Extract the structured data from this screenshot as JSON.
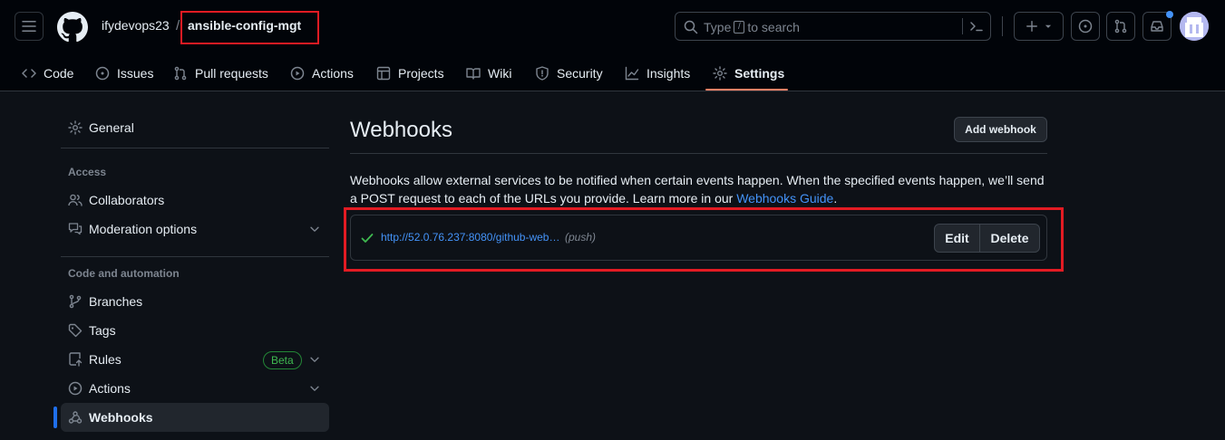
{
  "header": {
    "owner": "ifydevops23",
    "separator": "/",
    "repo": "ansible-config-mgt",
    "search": {
      "prefix": "Type",
      "key": "/",
      "suffix": "to search"
    },
    "icons": [
      "menu-icon",
      "github-logo-icon",
      "search-icon",
      "command-palette-icon",
      "plus-icon",
      "chevron-down-icon",
      "issues-icon",
      "pull-request-icon",
      "inbox-icon",
      "avatar"
    ]
  },
  "tabs": [
    {
      "label": "Code",
      "icon": "code-icon"
    },
    {
      "label": "Issues",
      "icon": "issue-opened-icon"
    },
    {
      "label": "Pull requests",
      "icon": "git-pull-request-icon"
    },
    {
      "label": "Actions",
      "icon": "play-icon"
    },
    {
      "label": "Projects",
      "icon": "table-icon"
    },
    {
      "label": "Wiki",
      "icon": "book-icon"
    },
    {
      "label": "Security",
      "icon": "shield-icon"
    },
    {
      "label": "Insights",
      "icon": "graph-icon"
    },
    {
      "label": "Settings",
      "icon": "gear-icon",
      "active": true
    }
  ],
  "sidebar": {
    "general": "General",
    "access_heading": "Access",
    "collaborators": "Collaborators",
    "moderation": "Moderation options",
    "code_heading": "Code and automation",
    "branches": "Branches",
    "tags": "Tags",
    "rules": "Rules",
    "rules_badge": "Beta",
    "actions": "Actions",
    "webhooks": "Webhooks"
  },
  "main": {
    "title": "Webhooks",
    "add_button": "Add webhook",
    "description_line1": "Webhooks allow external services to be notified when certain events happen. When the specified events happen, we’ll send",
    "description_line2_pre": "a POST request to each of the URLs you provide. Learn more in our ",
    "description_link": "Webhooks Guide",
    "description_line2_post": ".",
    "webhook": {
      "url": "http://52.0.76.237:8080/github-web…",
      "events": "(push)",
      "edit": "Edit",
      "delete": "Delete"
    }
  },
  "colors": {
    "background": "#0d1117",
    "header": "#010409",
    "link": "#4493f8",
    "active_tab_underline": "#f78166",
    "highlight_box": "#e31b23",
    "success": "#3fb950"
  }
}
